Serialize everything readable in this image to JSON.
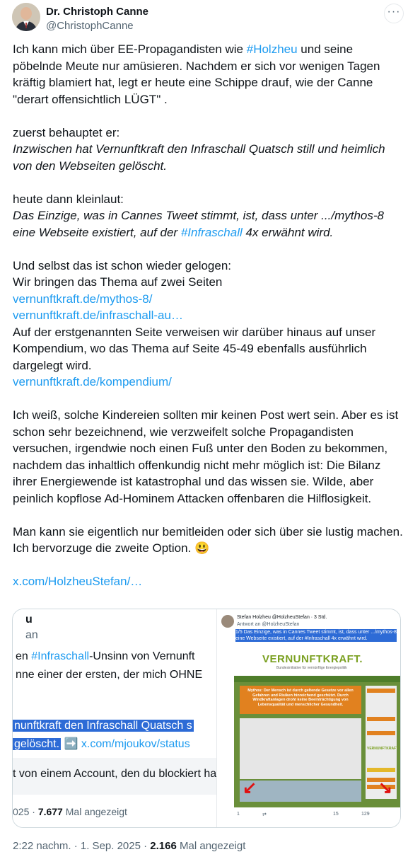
{
  "author": {
    "name": "Dr. Christoph Canne",
    "handle": "@ChristophCanne"
  },
  "more_label": "···",
  "body": {
    "p1_a": "Ich kann mich über EE-Propagandisten wie ",
    "p1_hashtag": "#Holzheu",
    "p1_b": " und seine pöbelnde Meute nur amüsieren. Nachdem er sich vor wenigen Tagen kräftig blamiert hat, legt er heute eine Schippe drauf, wie der Canne \"derart offensichtlich LÜGT\" .",
    "p2_intro": "zuerst behauptet er:",
    "p2_quote": "Inzwischen hat Vernunftkraft den Infraschall Quatsch still und heimlich von den Webseiten gelöscht.",
    "p3_intro": "heute dann kleinlaut:",
    "p3_quote_a": "Das Einzige, was in Cannes Tweet stimmt, ist, dass unter .../mythos-8 eine Webseite existiert, auf der ",
    "p3_hashtag": "#Infraschall",
    "p3_quote_b": " 4x erwähnt wird.",
    "p4_a": "Und selbst das ist schon wieder gelogen:",
    "p4_b": "Wir bringen das Thema auf zwei Seiten",
    "link1": "vernunftkraft.de/mythos-8/",
    "link2": "vernunftkraft.de/infraschall-au…",
    "p4_c": "Auf der erstgenannten Seite verweisen wir darüber hinaus auf unser Kompendium, wo das Thema auf Seite 45-49 ebenfalls ausführlich dargelegt wird.",
    "link3": "vernunftkraft.de/kompendium/",
    "p5": "Ich weiß, solche Kindereien sollten mir keinen Post wert sein. Aber es ist schon sehr bezeichnend, wie verzweifelt solche Propagandisten versuchen, irgendwie noch einen Fuß unter den Boden zu bekommen, nachdem das inhaltlich offenkundig nicht mehr möglich ist: Die Bilanz ihrer Energiewende ist katastrophal und das wissen sie. Wilde, aber peinlich kopflose Ad-Hominem Attacken offenbaren die Hilflosigkeit.",
    "p6_a": "Man kann sie eigentlich nur bemitleiden oder sich über sie lustig machen.",
    "p6_b": "Ich bervorzuge die zweite Option. 😃",
    "link4": "x.com/HolzheuStefan/…"
  },
  "card": {
    "left": {
      "l1": "u",
      "l2": "an",
      "l3_a": "en ",
      "l3_hashtag": "#Infraschall",
      "l3_b": "-Unsinn von Vernunft",
      "l4": "nne einer der ersten, der mich OHNE",
      "l5": "nunftkraft den Infraschall Quatsch s",
      "l6_a": " gelöscht.",
      "l6_b": "➡️",
      "l6_link": " x.com/mjoukov/status",
      "notice": "t von einem Account, den du blockiert ha",
      "stats_a": "025 · ",
      "stats_count": "7.677",
      "stats_b": " Mal angezeigt"
    },
    "right": {
      "head": "Stefan Holzheu @HolzheuStefan · 3 Std.",
      "reply_to": "Antwort an @HolzheuStefan",
      "quote": "1/5 Das Einzige, was in Cannes Tweet stimmt, ist, dass unter .../mythos-8 eine Webseite existiert, auf der #Infraschall 4x erwähnt wird.",
      "site_logo": "VERNUNFTKRAFT.",
      "site_tag": "Bundesinitiative für vernünftige Energiepolitik",
      "site_headline": "Mythos: Der Mensch ist durch geltende Gesetze vor allen Gefahren und Risiken hinreichend geschützt. Durch Windkraftanlagen droht keine Beeinträchtigung von Lebensqualität und menschlicher Gesundheit.",
      "side_logo": "VERNUNFTKRAFT",
      "actions": [
        "1",
        "15",
        "129"
      ]
    }
  },
  "meta": {
    "time": "2:22 nachm. · 1. Sep. 2025 · ",
    "views": "2.166",
    "views_label": " Mal angezeigt"
  }
}
